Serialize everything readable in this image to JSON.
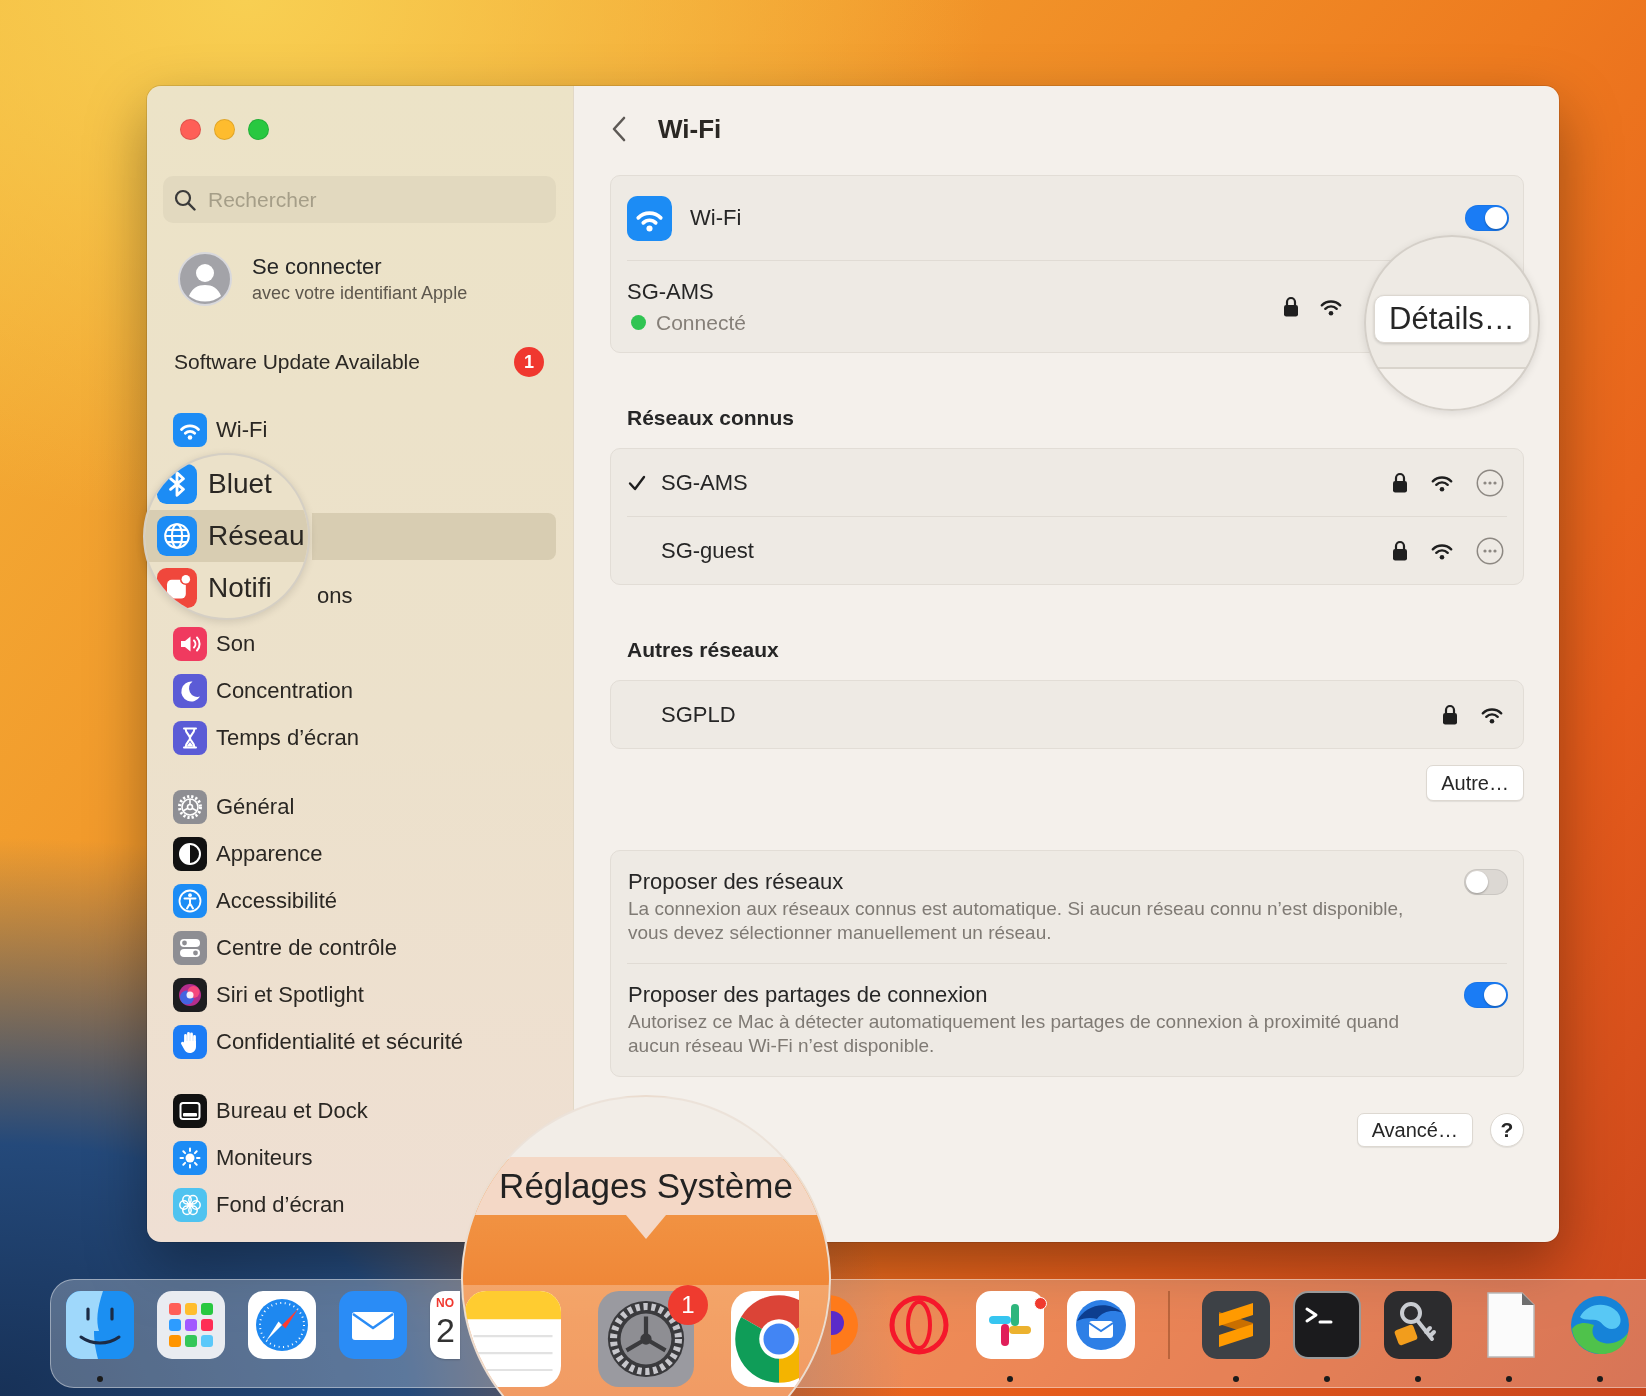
{
  "sidebar": {
    "search": {
      "placeholder": "Rechercher"
    },
    "account": {
      "title": "Se connecter",
      "subtitle": "avec votre identifiant Apple"
    },
    "update": {
      "label": "Software Update Available",
      "badge": "1"
    },
    "groups": [
      {
        "items": [
          {
            "kind": "wifi",
            "label": "Wi-Fi",
            "selected": false
          },
          {
            "kind": "lens",
            "rows": [
              {
                "kind": "bluetooth",
                "label": "Bluet",
                "selected": false
              },
              {
                "kind": "network",
                "label": "Réseau",
                "selected": true
              },
              {
                "kind": "notifications",
                "label": "Notifi",
                "fragment": "ons",
                "selected": false
              }
            ]
          },
          {
            "kind": "sound",
            "label": "Son",
            "selected": false
          },
          {
            "kind": "focus",
            "label": "Concentration",
            "selected": false
          },
          {
            "kind": "screentime",
            "label": "Temps d’écran",
            "selected": false
          }
        ]
      },
      {
        "items": [
          {
            "kind": "general",
            "label": "Général",
            "selected": false
          },
          {
            "kind": "appearance",
            "label": "Apparence",
            "selected": false
          },
          {
            "kind": "accessibility",
            "label": "Accessibilité",
            "selected": false
          },
          {
            "kind": "control",
            "label": "Centre de contrôle",
            "selected": false
          },
          {
            "kind": "siri",
            "label": "Siri et Spotlight",
            "selected": false
          },
          {
            "kind": "privacy",
            "label": "Confidentialité et sécurité",
            "selected": false
          }
        ]
      },
      {
        "items": [
          {
            "kind": "desktop",
            "label": "Bureau et Dock",
            "selected": false
          },
          {
            "kind": "displays",
            "label": "Moniteurs",
            "selected": false
          },
          {
            "kind": "wallpaper",
            "label": "Fond d’écran",
            "selected": false
          }
        ]
      }
    ]
  },
  "pane": {
    "title": "Wi-Fi",
    "wifi": {
      "label": "Wi-Fi",
      "on": true,
      "current": {
        "name": "SG-AMS",
        "status": "Connecté",
        "connected": true,
        "locked": true
      },
      "lens": {
        "button": "Détails…"
      }
    },
    "known": {
      "heading": "Réseaux connus",
      "networks": [
        {
          "name": "SG-AMS",
          "selected": true,
          "locked": true
        },
        {
          "name": "SG-guest",
          "selected": false,
          "locked": true
        }
      ]
    },
    "others": {
      "heading": "Autres réseaux",
      "networks": [
        {
          "name": "SGPLD",
          "selected": false,
          "locked": true
        }
      ],
      "button": "Autre…"
    },
    "options": [
      {
        "title": "Proposer des réseaux",
        "description": "La connexion aux réseaux connus est automatique. Si aucun réseau connu n’est disponible,\nvous devez sélectionner manuellement un réseau.",
        "on": false
      },
      {
        "title": "Proposer des partages de connexion",
        "description": "Autorisez ce Mac à détecter automatiquement les partages de connexion à proximité quand\naucun réseau Wi-Fi n’est disponible.",
        "on": true
      }
    ],
    "footer": {
      "advanced": "Avancé…",
      "help": "?"
    }
  },
  "dock": {
    "apps": [
      {
        "kind": "face",
        "running": true,
        "alert": false
      },
      {
        "kind": "grid",
        "running": false,
        "alert": false
      },
      {
        "kind": "compass",
        "running": false,
        "alert": false
      },
      {
        "kind": "envelope",
        "running": false,
        "alert": false
      },
      {
        "kind": "calendar",
        "running": false,
        "alert": false,
        "month": "NO",
        "day": "2"
      },
      {
        "kind": "lens",
        "tooltip": "Réglages Système",
        "apps": [
          {
            "kind": "notepad"
          },
          {
            "kind": "gear",
            "badge": "1"
          },
          {
            "kind": "segmented"
          }
        ]
      },
      {
        "kind": "orb",
        "running": false,
        "alert": false
      },
      {
        "kind": "ring",
        "running": false,
        "alert": false
      },
      {
        "kind": "pinwheel",
        "running": true,
        "alert": true
      },
      {
        "kind": "bird",
        "running": false,
        "alert": false
      },
      {
        "kind": "separator"
      },
      {
        "kind": "ribbon",
        "running": true,
        "alert": false
      },
      {
        "kind": "terminal",
        "running": true,
        "alert": false
      },
      {
        "kind": "keys",
        "running": true,
        "alert": false
      },
      {
        "kind": "document",
        "running": true,
        "alert": false
      },
      {
        "kind": "swirl",
        "running": true,
        "alert": false
      }
    ]
  }
}
